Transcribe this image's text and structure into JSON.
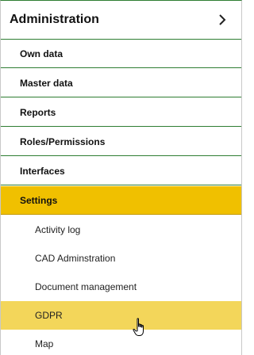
{
  "header": {
    "title": "Administration",
    "chevron_icon": "chevron-right-icon"
  },
  "menu_items": [
    {
      "label": "Own data"
    },
    {
      "label": "Master data"
    },
    {
      "label": "Reports"
    },
    {
      "label": "Roles/Permissions"
    },
    {
      "label": "Interfaces"
    },
    {
      "label": "Settings",
      "state": "active"
    }
  ],
  "sub_items": [
    {
      "label": "Activity log"
    },
    {
      "label": "CAD Adminstration"
    },
    {
      "label": "Document management"
    },
    {
      "label": "GDPR",
      "state": "hover"
    },
    {
      "label": "Map"
    }
  ],
  "colors": {
    "accent_green": "#2e7d32",
    "active_yellow": "#f0c000",
    "hover_yellow": "#f3d65a"
  },
  "cursor": "hand-pointer-icon"
}
